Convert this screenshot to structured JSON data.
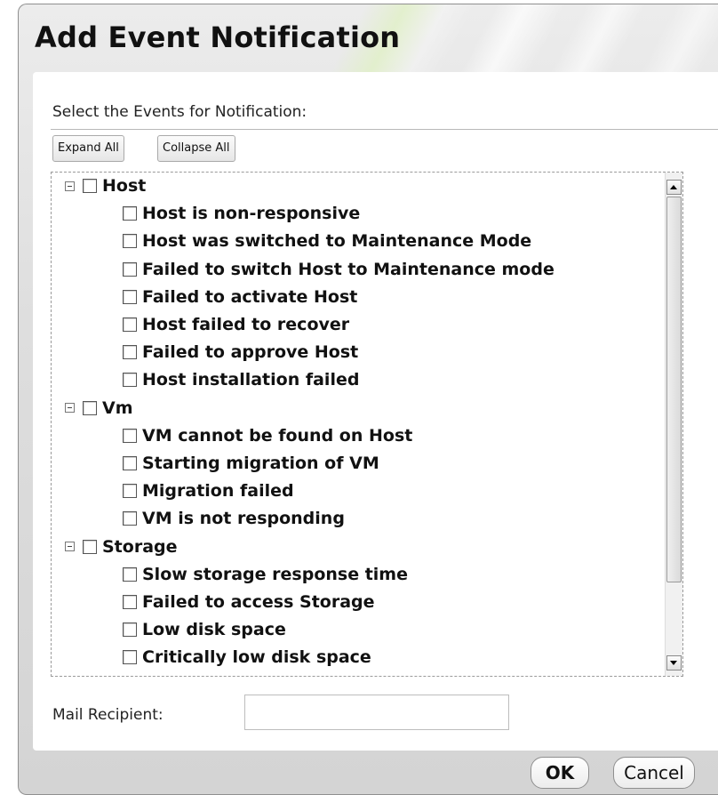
{
  "dialog": {
    "title": "Add Event Notification",
    "section_label": "Select the Events for Notification:",
    "expand_all_label": "Expand All",
    "collapse_all_label": "Collapse All",
    "groups": [
      {
        "label": "Host",
        "items": [
          "Host is non-responsive",
          "Host was switched to Maintenance Mode",
          "Failed to switch Host to Maintenance mode",
          "Failed to activate Host",
          "Host failed to recover",
          "Failed to approve Host",
          "Host installation failed"
        ]
      },
      {
        "label": "Vm",
        "items": [
          "VM cannot be found on Host",
          "Starting migration of VM",
          "Migration failed",
          "VM is not responding"
        ]
      },
      {
        "label": "Storage",
        "items": [
          "Slow storage response time",
          "Failed to access Storage",
          "Low disk space",
          "Critically low disk space"
        ]
      }
    ],
    "mail_recipient_label": "Mail Recipient:",
    "mail_recipient_value": "",
    "ok_label": "OK",
    "cancel_label": "Cancel"
  }
}
